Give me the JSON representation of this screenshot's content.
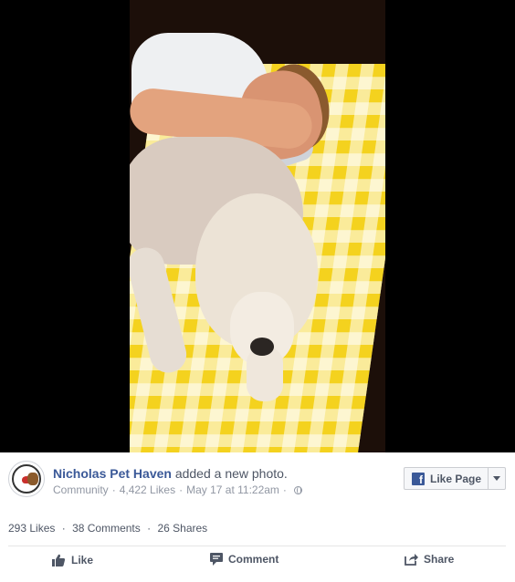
{
  "post": {
    "page_name": "Nicholas Pet Haven",
    "action_text": "added a new photo.",
    "category": "Community",
    "likes_count": "4,422 Likes",
    "date": "May 17 at 11:22am",
    "meta_separator": "·"
  },
  "like_page_button": {
    "label": "Like Page",
    "fb_letter": "f"
  },
  "stats": {
    "likes": "293 Likes",
    "comments": "38 Comments",
    "shares": "26 Shares",
    "separator": "·"
  },
  "actions": {
    "like": "Like",
    "comment": "Comment",
    "share": "Share"
  },
  "colors": {
    "brand": "#3b5998",
    "meta_text": "#9197a3",
    "action_text": "#4e5665"
  },
  "icons": [
    "globe-icon",
    "facebook-icon",
    "chevron-down-icon",
    "thumbs-up-icon",
    "comment-icon",
    "share-icon"
  ]
}
